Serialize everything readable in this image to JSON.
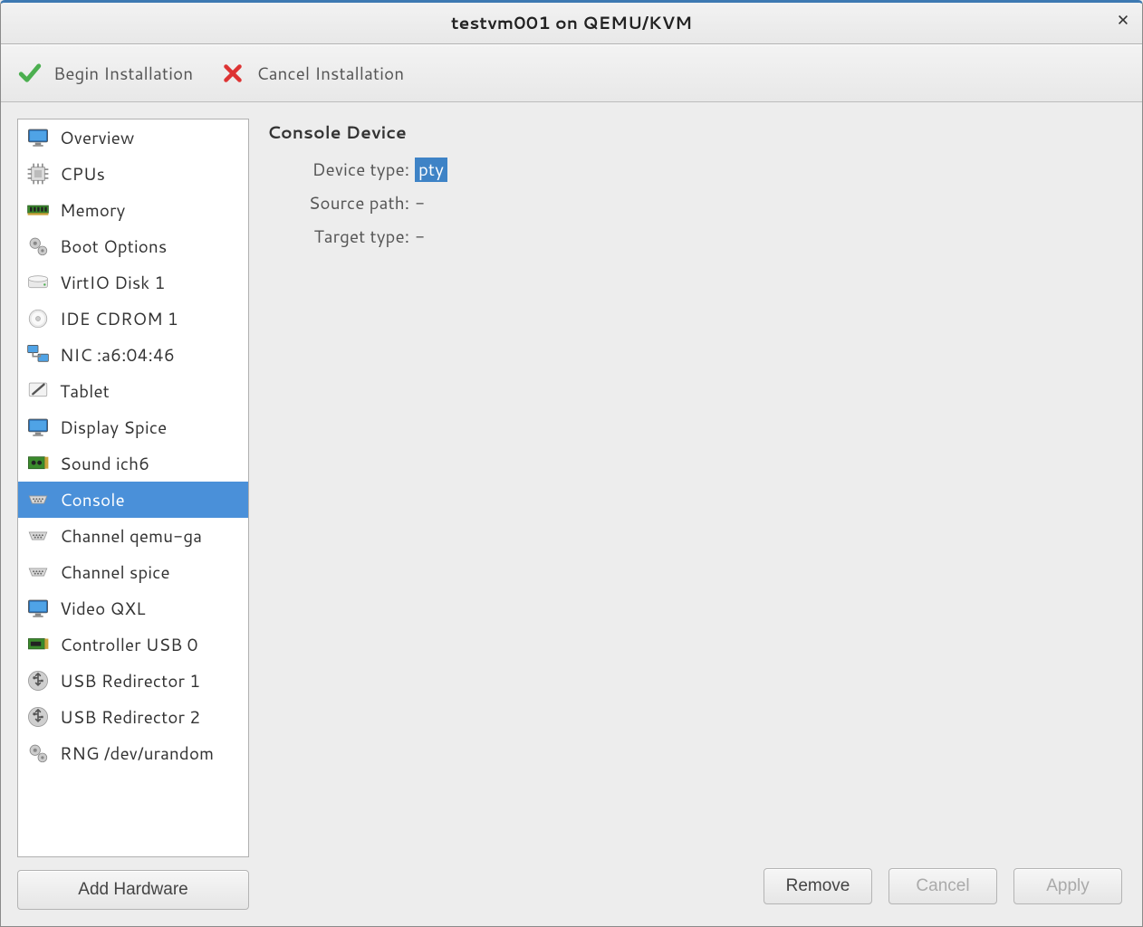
{
  "window": {
    "title": "testvm001 on QEMU/KVM"
  },
  "toolbar": {
    "begin": "Begin Installation",
    "cancel": "Cancel Installation"
  },
  "devices": [
    {
      "icon": "monitor",
      "label": "Overview"
    },
    {
      "icon": "cpu",
      "label": "CPUs"
    },
    {
      "icon": "memory",
      "label": "Memory"
    },
    {
      "icon": "gears",
      "label": "Boot Options"
    },
    {
      "icon": "disk",
      "label": "VirtIO Disk 1"
    },
    {
      "icon": "cdrom",
      "label": "IDE CDROM 1"
    },
    {
      "icon": "nic",
      "label": "NIC :a6:04:46"
    },
    {
      "icon": "tablet",
      "label": "Tablet"
    },
    {
      "icon": "monitor",
      "label": "Display Spice"
    },
    {
      "icon": "sound",
      "label": "Sound ich6"
    },
    {
      "icon": "serial",
      "label": "Console",
      "selected": true
    },
    {
      "icon": "serial",
      "label": "Channel qemu-ga"
    },
    {
      "icon": "serial",
      "label": "Channel spice"
    },
    {
      "icon": "monitor",
      "label": "Video QXL"
    },
    {
      "icon": "usbctrl",
      "label": "Controller USB 0"
    },
    {
      "icon": "usb",
      "label": "USB Redirector 1"
    },
    {
      "icon": "usb",
      "label": "USB Redirector 2"
    },
    {
      "icon": "gears",
      "label": "RNG /dev/urandom"
    }
  ],
  "add_hw": "Add Hardware",
  "panel": {
    "title": "Console Device",
    "rows": {
      "device_type_label": "Device type:",
      "device_type_value": "pty",
      "source_path_label": "Source path:",
      "source_path_value": "-",
      "target_type_label": "Target type:",
      "target_type_value": "-"
    }
  },
  "footer": {
    "remove": "Remove",
    "cancel": "Cancel",
    "apply": "Apply"
  }
}
